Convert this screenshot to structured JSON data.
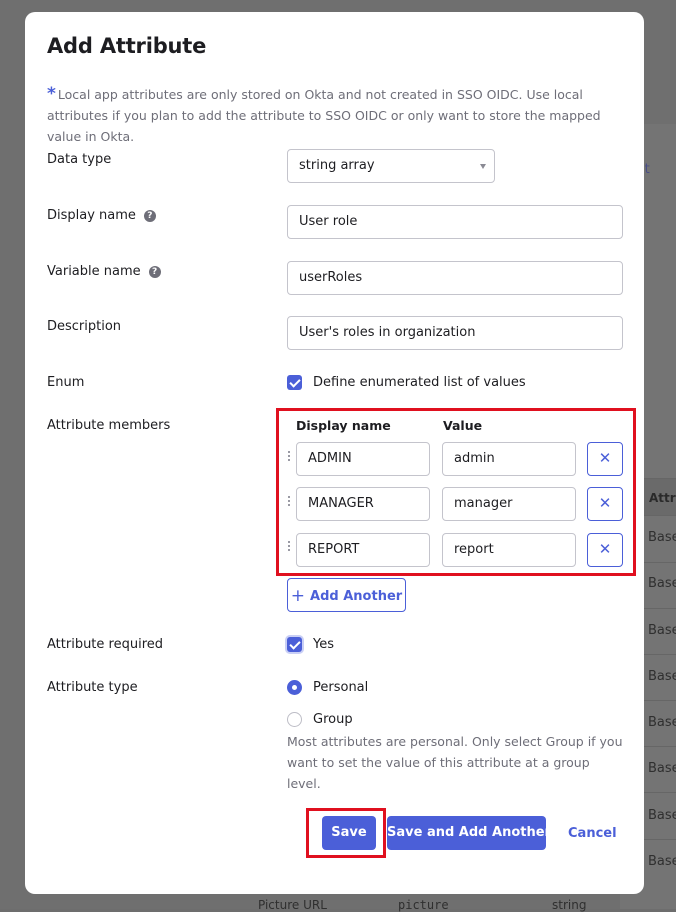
{
  "background": {
    "edit_link": "it",
    "table_header": "Attrib",
    "rows": [
      "Base",
      "Base",
      "Base",
      "Base",
      "Base",
      "Base",
      "Base",
      "Base"
    ],
    "bottom_row": {
      "name": "Picture URL",
      "variable": "picture",
      "type": "string"
    }
  },
  "modal": {
    "title": "Add Attribute",
    "note": "Local app attributes are only stored on Okta and not created in SSO OIDC. Use local attributes if you plan to add the attribute to SSO OIDC or only want to store the mapped value in Okta.",
    "note_marker": "*",
    "fields": {
      "data_type": {
        "label": "Data type",
        "value": "string array"
      },
      "display_name": {
        "label": "Display name",
        "value": "User role"
      },
      "variable_name": {
        "label": "Variable name",
        "value": "userRoles"
      },
      "description": {
        "label": "Description",
        "value": "User's roles in organization"
      },
      "enum": {
        "label": "Enum",
        "checkbox_label": "Define enumerated list of values",
        "checked": true
      }
    },
    "help_icon": "?",
    "members": {
      "label": "Attribute members",
      "col_display": "Display name",
      "col_value": "Value",
      "items": [
        {
          "display": "ADMIN",
          "value": "admin"
        },
        {
          "display": "MANAGER",
          "value": "manager"
        },
        {
          "display": "REPORT",
          "value": "report"
        }
      ],
      "remove_symbol": "✕",
      "add_symbol": "+",
      "add_label": "Add Another"
    },
    "required": {
      "label": "Attribute required",
      "checkbox_label": "Yes",
      "checked": true
    },
    "attr_type": {
      "label": "Attribute type",
      "options": [
        "Personal",
        "Group"
      ],
      "selected": "Personal",
      "help": "Most attributes are personal. Only select Group if you want to set the value of this attribute at a group level."
    },
    "buttons": {
      "save": "Save",
      "save_another": "Save and Add Another",
      "cancel": "Cancel"
    }
  },
  "colors": {
    "accent": "#4b5fd8",
    "highlight": "#e0101f",
    "overlay": "#6f6f6f"
  }
}
